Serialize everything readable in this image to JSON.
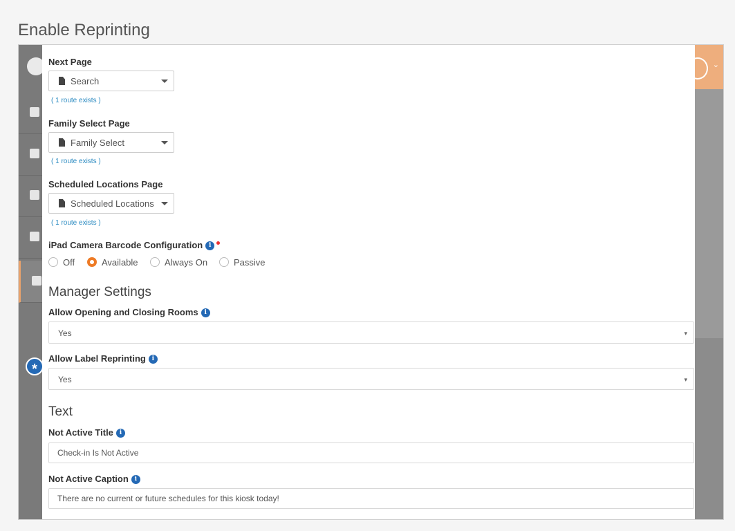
{
  "heading": "Enable Reprinting",
  "form": {
    "next_page": {
      "label": "Next Page",
      "value": "Search",
      "route": "( 1 route exists )"
    },
    "family_select_page": {
      "label": "Family Select Page",
      "value": "Family Select",
      "route": "( 1 route exists )"
    },
    "scheduled_locations_page": {
      "label": "Scheduled Locations Page",
      "value": "Scheduled Locations",
      "route": "( 1 route exists )"
    },
    "barcode_config": {
      "label": "iPad Camera Barcode Configuration",
      "options": [
        "Off",
        "Available",
        "Always On",
        "Passive"
      ],
      "selected": "Available"
    },
    "manager_settings": {
      "title": "Manager Settings",
      "allow_rooms": {
        "label": "Allow Opening and Closing Rooms",
        "value": "Yes"
      },
      "allow_reprint": {
        "label": "Allow Label Reprinting",
        "value": "Yes"
      }
    },
    "text_section": {
      "title": "Text",
      "not_active_title": {
        "label": "Not Active Title",
        "value": "Check-in Is Not Active"
      },
      "not_active_caption": {
        "label": "Not Active Caption",
        "value": "There are no current or future schedules for this kiosk today!"
      }
    }
  },
  "icons": {
    "info": "i",
    "caret": "▾",
    "asterisk": "*",
    "accent_color": "#ee7b26",
    "info_color": "#2469b5",
    "link_color": "#2a8ac1",
    "header_color": "#eeae7d"
  }
}
